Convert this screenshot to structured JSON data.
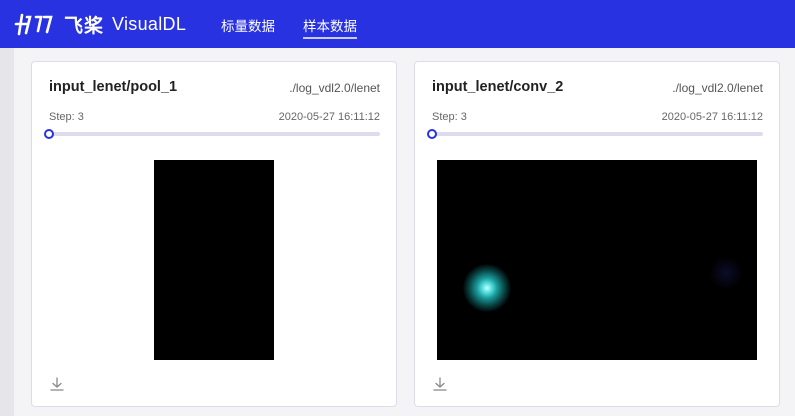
{
  "header": {
    "logo_cn": "飞桨",
    "brand": "VisualDL",
    "nav": [
      {
        "label": "标量数据",
        "active": false
      },
      {
        "label": "样本数据",
        "active": true
      }
    ],
    "color": "#2932e1"
  },
  "cards": [
    {
      "title": "input_lenet/pool_1",
      "run": "./log_vdl2.0/lenet",
      "step_label": "Step: 3",
      "time": "2020-05-27 16:11:12"
    },
    {
      "title": "input_lenet/conv_2",
      "run": "./log_vdl2.0/lenet",
      "step_label": "Step: 3",
      "time": "2020-05-27 16:11:12"
    }
  ],
  "icons": {
    "download": "download-icon"
  }
}
